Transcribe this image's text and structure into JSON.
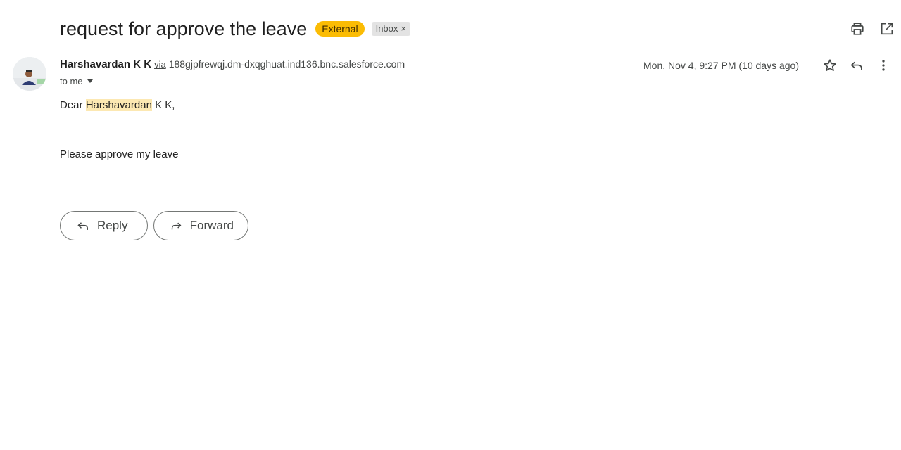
{
  "email": {
    "subject": "request for approve the leave",
    "labels": {
      "external": "External",
      "inbox": "Inbox",
      "inbox_remove": "×"
    },
    "sender": {
      "name": "Harshavardan K K",
      "via": "via",
      "via_domain": "188gjpfrewqj.dm-dxqghuat.ind136.bnc.salesforce.com"
    },
    "recipient": "to me",
    "date": "Mon, Nov 4, 9:27 PM (10 days ago)",
    "body": {
      "greeting_prefix": "Dear ",
      "greeting_highlight": "Harshavardan",
      "greeting_suffix": " K K,",
      "message": "Please approve my leave"
    }
  },
  "actions": {
    "reply": "Reply",
    "forward": "Forward"
  },
  "icons": {
    "print": "print-icon",
    "popout": "open-in-new-window-icon",
    "star": "star-icon",
    "reply": "reply-icon",
    "more": "more-vertical-icon",
    "forward": "forward-icon"
  },
  "colors": {
    "external_badge": "#fbbc04",
    "inbox_badge": "#e3e3e3",
    "highlight": "#fce8b2"
  }
}
